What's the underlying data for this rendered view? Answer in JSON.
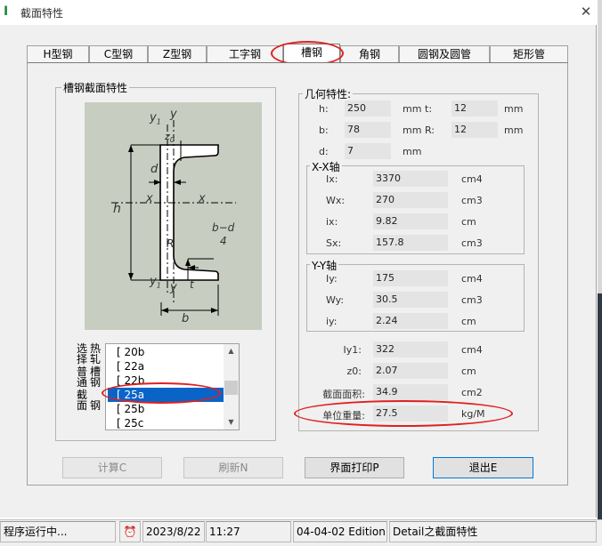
{
  "window": {
    "title": "截面特性",
    "app_icon": "I",
    "close_glyph": "✕"
  },
  "tabs": [
    {
      "label": "H型钢",
      "active": false
    },
    {
      "label": "C型钢",
      "active": false
    },
    {
      "label": "Z型钢",
      "active": false
    },
    {
      "label": "工字钢",
      "active": false
    },
    {
      "label": "槽钢",
      "active": true
    },
    {
      "label": "角钢",
      "active": false
    },
    {
      "label": "圆钢及圆管",
      "active": false
    },
    {
      "label": "矩形管",
      "active": false
    }
  ],
  "section_group": {
    "title": "槽钢截面特性",
    "diagram_labels": {
      "y1_top": "y",
      "y1_top_sub": "1",
      "y_top": "y",
      "z0": "z",
      "z0_sub": "0",
      "d": "d",
      "h": "h",
      "x_left": "x",
      "x_right": "x",
      "R": "R",
      "b_d": "b−d",
      "four": "4",
      "t": "t",
      "y1_bottom": "y",
      "y1_bottom_sub": "1",
      "y_bottom": "y",
      "b": "b"
    },
    "list_label_cols": [
      "热轧",
      "普通",
      "槽钢",
      "截面"
    ],
    "list_label_col0": "选择",
    "list_label_extra": "钢",
    "items": [
      "[   20b",
      "[   22a",
      "[   22b",
      "[   25a",
      "[   25b",
      "[   25c"
    ],
    "selected_index": 3
  },
  "geometry": {
    "title": "几何特性:",
    "h_label": "h:",
    "h_value": "250",
    "h_unit": "mm",
    "t_label": "t:",
    "t_value": "12",
    "t_unit": "mm",
    "b_label": "b:",
    "b_value": "78",
    "b_unit": "mm",
    "R_label": "R:",
    "R_value": "12",
    "R_unit": "mm",
    "d_label": "d:",
    "d_value": "7",
    "d_unit": "mm"
  },
  "xx_axis": {
    "title": "X-X轴",
    "rows": [
      {
        "label": "Ix:",
        "value": "3370",
        "unit": "cm4"
      },
      {
        "label": "Wx:",
        "value": "270",
        "unit": "cm3"
      },
      {
        "label": "ix:",
        "value": "9.82",
        "unit": "cm"
      },
      {
        "label": "Sx:",
        "value": "157.8",
        "unit": "cm3"
      }
    ]
  },
  "yy_axis": {
    "title": "Y-Y轴",
    "rows": [
      {
        "label": "Iy:",
        "value": "175",
        "unit": "cm4"
      },
      {
        "label": "Wy:",
        "value": "30.5",
        "unit": "cm3"
      },
      {
        "label": "iy:",
        "value": "2.24",
        "unit": "cm"
      }
    ]
  },
  "extra": {
    "rows": [
      {
        "label": "Iy1:",
        "value": "322",
        "unit": "cm4"
      },
      {
        "label": "z0:",
        "value": "2.07",
        "unit": "cm"
      },
      {
        "label": "截面面积:",
        "value": "34.9",
        "unit": "cm2"
      },
      {
        "label": "单位重量:",
        "value": "27.5",
        "unit": "kg/M"
      }
    ]
  },
  "buttons": {
    "calc": "计算C",
    "refresh": "刷新N",
    "print": "界面打印P",
    "exit": "退出E"
  },
  "status": {
    "running": "程序运行中...",
    "date": "2023/8/22",
    "time": "11:27",
    "edition": "04-04-02 Edition",
    "detail": "Detail之截面特性"
  },
  "colors": {
    "highlight_ellipse": "#e02020",
    "selection": "#0a64c8",
    "diagram_bg": "#c7cdc0"
  }
}
